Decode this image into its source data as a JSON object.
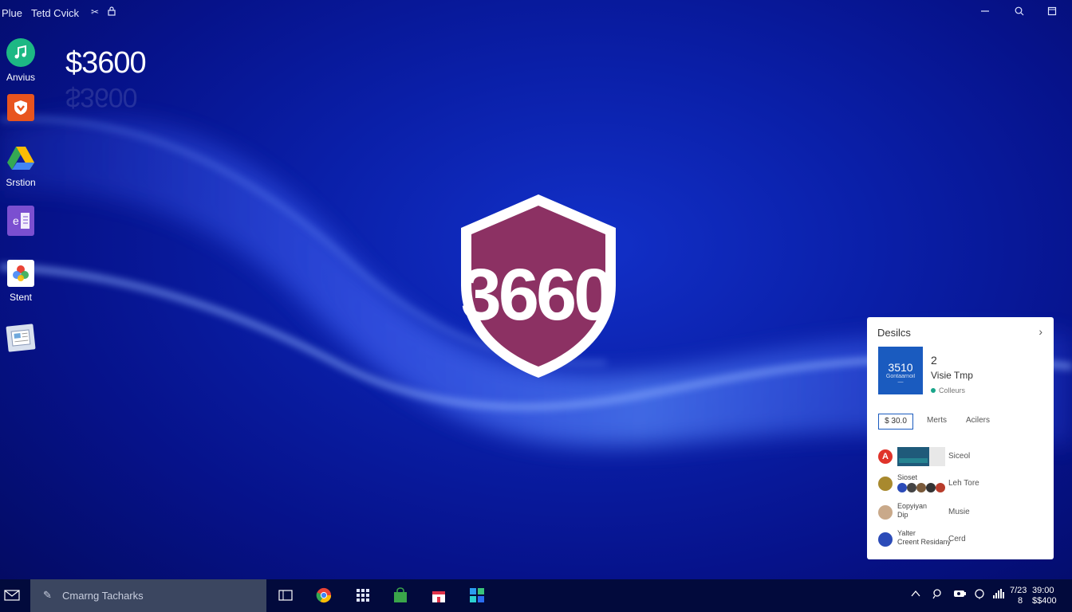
{
  "topbar": {
    "app_name": "Plue",
    "menu_item": "Tetd Cvick",
    "icon1": "scissors-icon",
    "icon2": "lock-icon",
    "right_icons": [
      "minimize-icon",
      "search-icon",
      "window-icon"
    ]
  },
  "desktop": {
    "icons": [
      {
        "name": "music-icon",
        "label": "Anvius",
        "color": "#1db884"
      },
      {
        "name": "shield-app-icon",
        "label": "",
        "color": "#e8541e"
      },
      {
        "name": "drive-icon",
        "label": "Srstion",
        "color": "#34a853"
      },
      {
        "name": "onenote-icon",
        "label": "",
        "color": "#7b4fd0"
      },
      {
        "name": "photos-icon",
        "label": "Stent",
        "color": "#ffffff"
      },
      {
        "name": "image-viewer-icon",
        "label": "",
        "color": "#d8e0ee"
      }
    ],
    "big_number": "$3600",
    "big_number_reflection": "$3600"
  },
  "center_logo": {
    "text": "3660",
    "shield_color": "#8c3163"
  },
  "panel": {
    "header": "Desilcs",
    "tile_main": "3510",
    "tile_sub": "Gontaarnoil",
    "tile_dash": "—",
    "count": "2",
    "subtitle": "Visie Tmp",
    "status": "Colleurs",
    "chip": "$ 30.0",
    "tabs": [
      "Merts",
      "Acilers"
    ],
    "rows": [
      {
        "avatar_color": "#e0332a",
        "mid": "",
        "right": "Siceol"
      },
      {
        "avatar_color": "#a8892e",
        "mid": "Sioset",
        "right": "Leh Tore"
      },
      {
        "avatar_color": "#c9a98a",
        "mid": "Eopyiyan\nDip",
        "right": "Musie"
      },
      {
        "avatar_color": "#2b4bb8",
        "mid": "Yalter\nCreent Residany",
        "right": "Cerd"
      }
    ]
  },
  "taskbar": {
    "search_text": "Cmarng Tacharks",
    "apps": [
      "task-view-icon",
      "chrome-icon",
      "apps-grid-icon",
      "shopping-bag-icon",
      "store-icon",
      "widgets-icon"
    ],
    "tray_icons": [
      "chevron-up-icon",
      "network-icon",
      "battery-icon",
      "wifi-icon",
      "volume-icon"
    ],
    "clock_time": "7/23",
    "clock_date": "8",
    "clock_right_1": "39:00",
    "clock_right_2": "$$400"
  }
}
